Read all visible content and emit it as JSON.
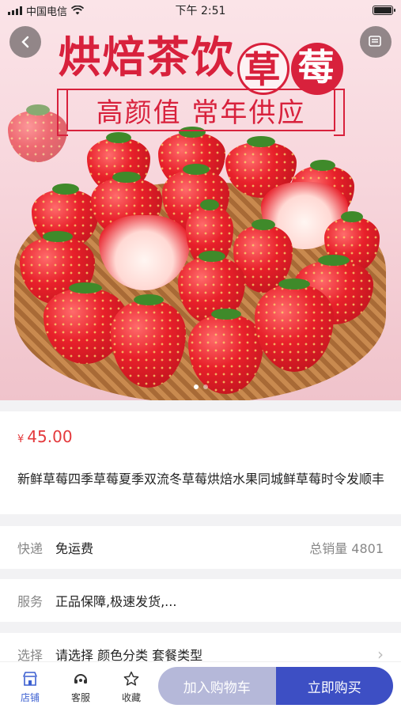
{
  "status_bar": {
    "carrier": "中国电信",
    "time": "下午 2:51"
  },
  "hero": {
    "title_prefix": "烘焙茶饮",
    "title_char_1": "草",
    "title_char_2": "莓",
    "subtitle": "高颜值 常年供应",
    "carousel_count": 2,
    "carousel_active": 0
  },
  "product": {
    "currency": "¥",
    "price": "45.00",
    "title": "新鲜草莓四季草莓夏季双流冬草莓烘焙水果同城鲜草莓时令发顺丰"
  },
  "shipping": {
    "label": "快递",
    "value": "免运费",
    "sales": "总销量 4801"
  },
  "service": {
    "label": "服务",
    "value": "正品保障,极速发货,..."
  },
  "options": {
    "label": "选择",
    "value": "请选择 颜色分类 套餐类型"
  },
  "bottom_bar": {
    "tabs": [
      {
        "label": "店铺",
        "icon": "store-icon"
      },
      {
        "label": "客服",
        "icon": "headset-icon"
      },
      {
        "label": "收藏",
        "icon": "star-icon"
      }
    ],
    "add_to_cart": "加入购物车",
    "buy_now": "立即购买"
  },
  "colors": {
    "price": "#e4393c",
    "accent": "#3d4fc4",
    "cart_button": "#b5b8d9",
    "brand_red": "#d8213c"
  }
}
